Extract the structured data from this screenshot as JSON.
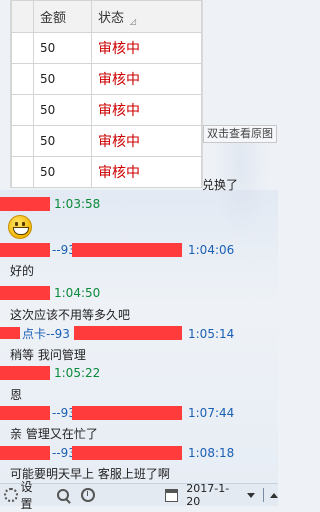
{
  "image_table": {
    "headers": [
      "",
      "金额",
      "状态"
    ],
    "rows": [
      {
        "amount": "50",
        "status": "审核中"
      },
      {
        "amount": "50",
        "status": "审核中"
      },
      {
        "amount": "50",
        "status": "审核中"
      },
      {
        "amount": "50",
        "status": "审核中"
      },
      {
        "amount": "50",
        "status": "审核中"
      }
    ]
  },
  "view_image_tip": "双击查看原图",
  "side_message": "兑换了",
  "messages": [
    {
      "name": "",
      "time": "1:03:58",
      "text": ""
    },
    {
      "name": "--93",
      "time": "1:04:06",
      "text": "好的"
    },
    {
      "name": "",
      "time": "1:04:50",
      "text": "这次应该不用等多久吧"
    },
    {
      "name": "点卡--93",
      "time": "1:05:14",
      "text": "稍等  我问管理"
    },
    {
      "name": "",
      "time": "1:05:22",
      "text": "恩"
    },
    {
      "name": "--93",
      "time": "1:07:44",
      "text": "亲 管理又在忙了"
    },
    {
      "name": "--93",
      "time": "1:08:18",
      "text": "可能要明天早上  客服上班了啊"
    }
  ],
  "toolbar": {
    "settings_label": "设置",
    "date": "2017-1-20"
  },
  "colors": {
    "status_red": "#cc0000",
    "time_green": "#0a8a3a",
    "time_blue": "#1a5fb4",
    "redaction": "#ff3b3b"
  }
}
